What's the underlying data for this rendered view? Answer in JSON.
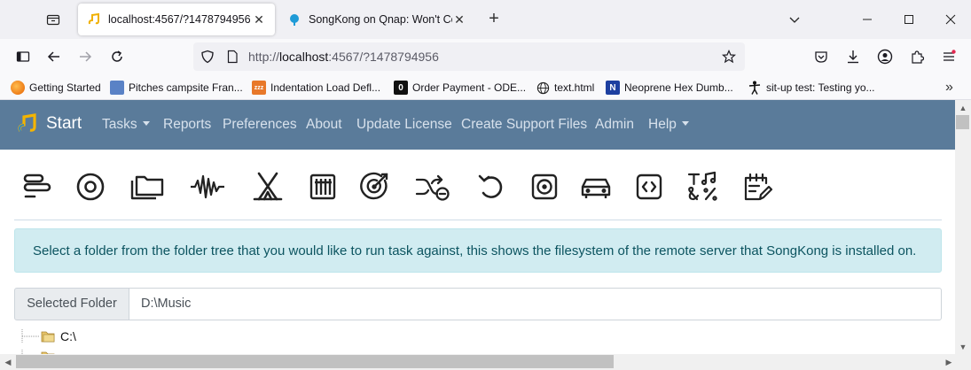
{
  "browser": {
    "tabs": [
      {
        "title": "localhost:4567/?1478794956",
        "active": true
      },
      {
        "title": "SongKong on Qnap: Won't Con",
        "active": false
      }
    ],
    "url_prefix": "http://",
    "url_host": "localhost",
    "url_rest": ":4567/?1478794956",
    "bookmarks": [
      {
        "label": "Getting Started",
        "icon": "firefox-icon"
      },
      {
        "label": "Pitches campsite Fran...",
        "icon": "campsite-icon"
      },
      {
        "label": "Indentation Load Defl...",
        "icon": "zzz-icon"
      },
      {
        "label": "Order Payment - ODE...",
        "icon": "ode-icon",
        "icon_text": "0"
      },
      {
        "label": "text.html",
        "icon": "globe-icon"
      },
      {
        "label": "Neoprene Hex Dumb...",
        "icon": "n-icon"
      },
      {
        "label": "sit-up test: Testing yo...",
        "icon": "person-icon"
      }
    ]
  },
  "app": {
    "brand": "Start",
    "menu": [
      {
        "label": "Tasks",
        "dropdown": true
      },
      {
        "label": "Reports",
        "dropdown": false
      },
      {
        "label": "Preferences",
        "dropdown": false
      },
      {
        "label": "About",
        "dropdown": false
      },
      {
        "label": "Update License",
        "dropdown": false
      },
      {
        "label": "Create Support Files",
        "dropdown": false
      },
      {
        "label": "Admin",
        "dropdown": false
      },
      {
        "label": "Help",
        "dropdown": true
      }
    ],
    "info_message": "Select a folder from the folder tree that you would like to run task against, this shows the filesystem of the remote server that SongKong is installed on.",
    "selected_folder_label": "Selected Folder",
    "selected_folder_value": "D:\\Music",
    "tree": [
      {
        "label": "C:\\"
      }
    ],
    "colors": {
      "navbar": "#5a7b9a",
      "alert_bg": "#d1ecf1",
      "alert_text": "#0c5460"
    }
  }
}
